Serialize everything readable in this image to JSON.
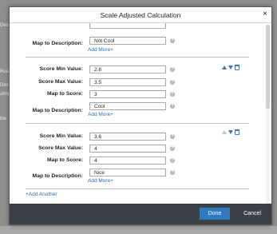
{
  "background": {
    "fragments": [
      "Des",
      "Rou",
      "Des",
      "ating",
      "ble"
    ]
  },
  "dialog": {
    "title": "Scale Adjusted Calculation",
    "close_glyph": "×"
  },
  "labels": {
    "score_min": "Score Min Value:",
    "score_max": "Score Max Value:",
    "map_score": "Map to Score:",
    "map_desc": "Map to Description:",
    "add_more": "Add More+",
    "help_glyph": "?"
  },
  "rows": [
    {
      "map_desc_value": "Not Cool"
    },
    {
      "score_min": "2.6",
      "score_max": "3.5",
      "map_score": "3",
      "map_desc_value": "Cool"
    },
    {
      "score_min": "3.6",
      "score_max": "4",
      "map_score": "4",
      "map_desc_value": "Nice"
    }
  ],
  "add_another": "+Add Another",
  "footer": {
    "done": "Done",
    "cancel": "Cancel"
  },
  "icons": [
    "up-arrow-icon",
    "down-arrow-icon",
    "trash-icon",
    "help-icon",
    "close-icon"
  ],
  "colors": {
    "link": "#2a6ab5",
    "primary_button": "#2f79c2",
    "footer_bg": "#3b4049",
    "overlay": "#8f8f8f"
  }
}
